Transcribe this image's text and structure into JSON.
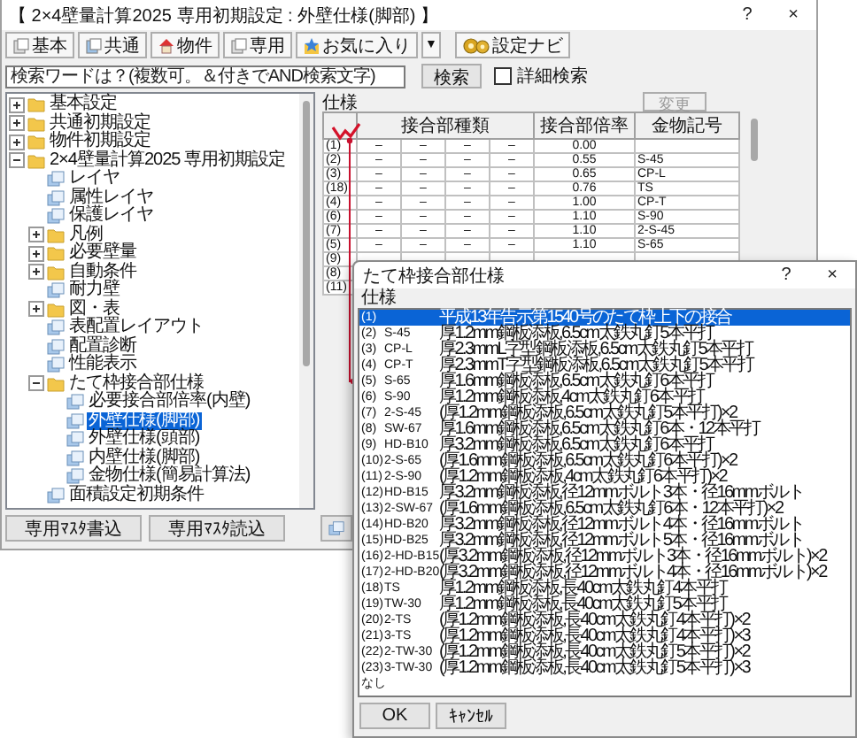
{
  "window": {
    "title": "【 2×4壁量計算2025 専用初期設定 : 外壁仕様(脚部) 】",
    "help": "?",
    "close": "×"
  },
  "toolbar": [
    {
      "label": "基本"
    },
    {
      "label": "共通"
    },
    {
      "label": "物件"
    },
    {
      "label": "専用"
    },
    {
      "label": "お気に入り"
    },
    {
      "label": "▼"
    },
    {
      "label": "設定ナビ"
    }
  ],
  "search": {
    "placeholder": "検索ワードは？(複数可。＆付きでAND検索文字)",
    "button": "検索",
    "detail": {
      "label": "詳細検索",
      "checked": false
    }
  },
  "tree": {
    "items": [
      {
        "label": "基本設定",
        "kind": "folder",
        "expanded": false,
        "selected": false
      },
      {
        "label": "共通初期設定",
        "kind": "folder",
        "expanded": false,
        "selected": false
      },
      {
        "label": "物件初期設定",
        "kind": "folder",
        "expanded": false,
        "selected": false
      },
      {
        "label": "2×4壁量計算2025 専用初期設定",
        "kind": "folder",
        "expanded": true,
        "selected": false,
        "children": [
          {
            "label": "レイヤ",
            "kind": "page",
            "selected": false
          },
          {
            "label": "属性レイヤ",
            "kind": "page",
            "selected": false
          },
          {
            "label": "保護レイヤ",
            "kind": "page",
            "selected": false
          },
          {
            "label": "凡例",
            "kind": "folder",
            "expanded": false,
            "selected": false
          },
          {
            "label": "必要壁量",
            "kind": "folder",
            "expanded": false,
            "selected": false
          },
          {
            "label": "自動条件",
            "kind": "folder",
            "expanded": false,
            "selected": false
          },
          {
            "label": "耐力壁",
            "kind": "page",
            "selected": false
          },
          {
            "label": "図・表",
            "kind": "folder",
            "expanded": false,
            "selected": false
          },
          {
            "label": "表配置レイアウト",
            "kind": "page",
            "selected": false
          },
          {
            "label": "配置診断",
            "kind": "page",
            "selected": false
          },
          {
            "label": "性能表示",
            "kind": "page",
            "selected": false
          },
          {
            "label": "たて枠接合部仕様",
            "kind": "folder",
            "expanded": true,
            "selected": false,
            "children": [
              {
                "label": "必要接合部倍率(内壁)",
                "kind": "page",
                "selected": false
              },
              {
                "label": "外壁仕様(脚部)",
                "kind": "page",
                "selected": true
              },
              {
                "label": "外壁仕様(頭部)",
                "kind": "page",
                "selected": false
              },
              {
                "label": "内壁仕様(脚部)",
                "kind": "page",
                "selected": false
              },
              {
                "label": "金物仕様(簡易計算法)",
                "kind": "page",
                "selected": false
              }
            ]
          },
          {
            "label": "面積設定初期条件",
            "kind": "page",
            "selected": false
          }
        ]
      }
    ]
  },
  "bottom_buttons": [
    "専用ﾏｽﾀ書込",
    "専用ﾏｽﾀ読込"
  ],
  "spec": {
    "label": "仕様",
    "change_button": {
      "label": "変更",
      "disabled": true
    },
    "header": {
      "types": "接合部種類",
      "rate": "接合部倍率",
      "code": "金物記号"
    },
    "rows": [
      {
        "no": "(1)",
        "types": [
          "–",
          "–",
          "–",
          "–"
        ],
        "rate": "0.00"
      },
      {
        "no": "(2)",
        "types": [
          "–",
          "–",
          "–",
          "–"
        ],
        "rate": "0.55",
        "code": "S-45"
      },
      {
        "no": "(3)",
        "types": [
          "–",
          "–",
          "–",
          "–"
        ],
        "rate": "0.65",
        "code": "CP-L"
      },
      {
        "no": "(18)",
        "types": [
          "–",
          "–",
          "–",
          "–"
        ],
        "rate": "0.76",
        "code": "TS"
      },
      {
        "no": "(4)",
        "types": [
          "–",
          "–",
          "–",
          "–"
        ],
        "rate": "1.00",
        "code": "CP-T"
      },
      {
        "no": "(6)",
        "types": [
          "–",
          "–",
          "–",
          "–"
        ],
        "rate": "1.10",
        "code": "S-90"
      },
      {
        "no": "(7)",
        "types": [
          "–",
          "–",
          "–",
          "–"
        ],
        "rate": "1.10",
        "code": "2-S-45"
      },
      {
        "no": "(5)",
        "types": [
          "–",
          "–",
          "–",
          "–"
        ],
        "rate": "1.10",
        "code": "S-65"
      },
      {
        "no": "(9)"
      },
      {
        "no": "(8)"
      },
      {
        "no": "(11)"
      }
    ]
  },
  "dialog": {
    "title": "たて枠接合部仕様",
    "help": "?",
    "close": "×",
    "label": "仕様",
    "items": [
      {
        "no": "(1)",
        "desc": "平成13年告示第1540号のたて枠上下の接合",
        "selected": true
      },
      {
        "no": "(2)",
        "code": "S-45",
        "desc": "厚1.2mm鋼板添板,6.5cm太鉄丸釘5本平打",
        "selected": false
      },
      {
        "no": "(3)",
        "code": "CP-L",
        "desc": "厚2.3mmL字型鋼板添板,6.5cm太鉄丸釘5本平打",
        "selected": false
      },
      {
        "no": "(4)",
        "code": "CP-T",
        "desc": "厚2.3mmT字型鋼板添板,6.5cm太鉄丸釘5本平打",
        "selected": false
      },
      {
        "no": "(5)",
        "code": "S-65",
        "desc": "厚1.6mm鋼板添板,6.5cm太鉄丸釘6本平打",
        "selected": false
      },
      {
        "no": "(6)",
        "code": "S-90",
        "desc": "厚1.2mm鋼板添板,4cm太鉄丸釘6本平打",
        "selected": false
      },
      {
        "no": "(7)",
        "code": "2-S-45",
        "desc": "(厚1.2mm鋼板添板,6.5cm太鉄丸釘5本平打)×2",
        "selected": false
      },
      {
        "no": "(8)",
        "code": "SW-67",
        "desc": "厚1.6mm鋼板添板,6.5cm太鉄丸釘6本・12本平打",
        "selected": false
      },
      {
        "no": "(9)",
        "code": "HD-B10",
        "desc": "厚3.2mm鋼板添板,6.5cm太鉄丸釘6本平打",
        "selected": false
      },
      {
        "no": "(10)",
        "code": "2-S-65",
        "desc": "(厚1.6mm鋼板添板,6.5cm太鉄丸釘6本平打)×2",
        "selected": false
      },
      {
        "no": "(11)",
        "code": "2-S-90",
        "desc": "(厚1.2mm鋼板添板,4cm太鉄丸釘6本平打)×2",
        "selected": false
      },
      {
        "no": "(12)",
        "code": "HD-B15",
        "desc": "厚3.2mm鋼板添板,径12mmボルト3本・径16mmボルト",
        "selected": false
      },
      {
        "no": "(13)",
        "code": "2-SW-67",
        "desc": "(厚1.6mm鋼板添板,6.5cm太鉄丸釘6本・12本平打)×2",
        "selected": false
      },
      {
        "no": "(14)",
        "code": "HD-B20",
        "desc": "厚3.2mm鋼板添板,径12mmボルト4本・径16mmボルト",
        "selected": false
      },
      {
        "no": "(15)",
        "code": "HD-B25",
        "desc": "厚3.2mm鋼板添板,径12mmボルト5本・径16mmボルト",
        "selected": false
      },
      {
        "no": "(16)",
        "code": "2-HD-B15",
        "desc": "(厚3.2mm鋼板添板,径12mmボルト3本・径16mmボルト)×2",
        "selected": false
      },
      {
        "no": "(17)",
        "code": "2-HD-B20",
        "desc": "(厚3.2mm鋼板添板,径12mmボルト4本・径16mmボルト)×2",
        "selected": false
      },
      {
        "no": "(18)",
        "code": "TS",
        "desc": "厚1.2mm鋼板添板,長40cm太鉄丸釘4本平打",
        "selected": false
      },
      {
        "no": "(19)",
        "code": "TW-30",
        "desc": "厚1.2mm鋼板添板,長40cm太鉄丸釘5本平打",
        "selected": false
      },
      {
        "no": "(20)",
        "code": "2-TS",
        "desc": "(厚1.2mm鋼板添板,長40cm太鉄丸釘4本平打)×2",
        "selected": false
      },
      {
        "no": "(21)",
        "code": "3-TS",
        "desc": "(厚1.2mm鋼板添板,長40cm太鉄丸釘4本平打)×3",
        "selected": false
      },
      {
        "no": "(22)",
        "code": "2-TW-30",
        "desc": "(厚1.2mm鋼板添板,長40cm太鉄丸釘5本平打)×2",
        "selected": false
      },
      {
        "no": "(23)",
        "code": "3-TW-30",
        "desc": "(厚1.2mm鋼板添板,長40cm太鉄丸釘5本平打)×3",
        "selected": false
      },
      {
        "no": "なし",
        "selected": false
      }
    ],
    "buttons": [
      "OK",
      "ｷｬﾝｾﾙ"
    ]
  }
}
